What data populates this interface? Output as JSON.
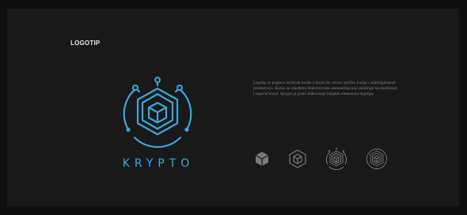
{
  "heading": "LOGOTIP",
  "brand": {
    "wordmark": "KRYPTO",
    "accent_color": "#3aa7d9"
  },
  "description": "Logotip se pogiava motivom kocke u kocki što stvara optičku iluziju i zainteigiranost promatrača. Kocka su omeđene dekorativnim elementima koji aludiraju na mističnost i zapečaćenost. tipogra ja prati oblikovanje linijskih elemenata logotipa.",
  "variants": [
    {
      "icon": "cube-solid-icon"
    },
    {
      "icon": "cube-outline-icon"
    },
    {
      "icon": "cube-ornate-icon"
    },
    {
      "icon": "cube-ornate-thin-icon"
    }
  ],
  "colors": {
    "background": "#191919",
    "variant_gray": "#7a7a7a"
  }
}
